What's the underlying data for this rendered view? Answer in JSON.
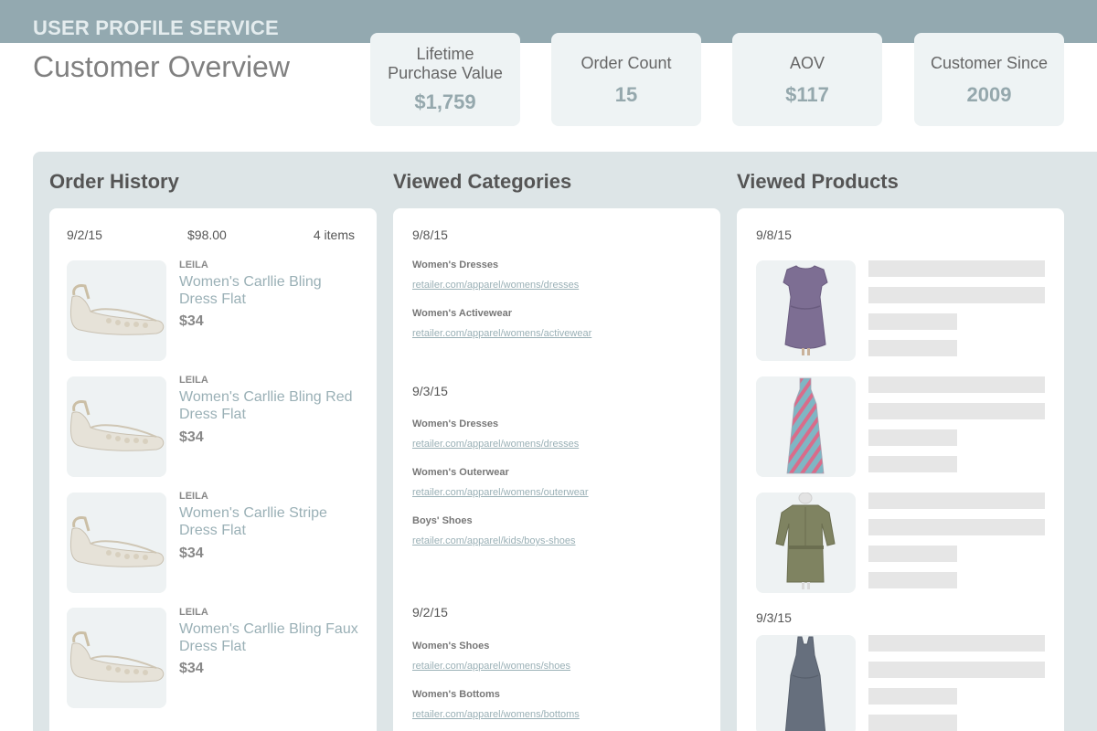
{
  "header": {
    "service_name": "USER PROFILE SERVICE",
    "page_title": "Customer Overview"
  },
  "metrics": [
    {
      "label": "Lifetime Purchase Value",
      "value": "$1,759"
    },
    {
      "label": "Order Count",
      "value": "15"
    },
    {
      "label": "AOV",
      "value": "$117"
    },
    {
      "label": "Customer Since",
      "value": "2009"
    }
  ],
  "order_history": {
    "title": "Order History",
    "order": {
      "date": "9/2/15",
      "total": "$98.00",
      "items_count": "4 items",
      "items": [
        {
          "brand": "LEILA",
          "name": "Women's Carllie Bling Dress Flat",
          "price": "$34",
          "icon": "sandal-icon"
        },
        {
          "brand": "LEILA",
          "name": "Women's Carllie Bling Red Dress Flat",
          "price": "$34",
          "icon": "sandal-icon"
        },
        {
          "brand": "LEILA",
          "name": "Women's Carllie Stripe Dress Flat",
          "price": "$34",
          "icon": "sandal-icon"
        },
        {
          "brand": "LEILA",
          "name": "Women's Carllie Bling Faux Dress Flat",
          "price": "$34",
          "icon": "sandal-icon"
        }
      ]
    }
  },
  "viewed_categories": {
    "title": "Viewed Categories",
    "groups": [
      {
        "date": "9/8/15",
        "items": [
          {
            "name": "Women's Dresses",
            "url": "retailer.com/apparel/womens/dresses"
          },
          {
            "name": "Women's Activewear",
            "url": "retailer.com/apparel/womens/activewear"
          }
        ]
      },
      {
        "date": "9/3/15",
        "items": [
          {
            "name": "Women's Dresses",
            "url": "retailer.com/apparel/womens/dresses"
          },
          {
            "name": "Women's Outerwear",
            "url": "retailer.com/apparel/womens/outerwear"
          },
          {
            "name": "Boys' Shoes",
            "url": "retailer.com/apparel/kids/boys-shoes"
          }
        ]
      },
      {
        "date": "9/2/15",
        "items": [
          {
            "name": "Women's Shoes",
            "url": "retailer.com/apparel/womens/shoes"
          },
          {
            "name": "Women's Bottoms",
            "url": "retailer.com/apparel/womens/bottoms"
          }
        ]
      }
    ]
  },
  "viewed_products": {
    "title": "Viewed Products",
    "groups": [
      {
        "date": "9/8/15",
        "products": [
          {
            "icon": "purple-dress-icon",
            "color": "#7d6e93"
          },
          {
            "icon": "striped-maxi-dress-icon",
            "color": "#d96c8a"
          },
          {
            "icon": "olive-shirt-dress-icon",
            "color": "#7f8361"
          }
        ]
      },
      {
        "date": "9/3/15",
        "products": [
          {
            "icon": "gray-maxi-dress-icon",
            "color": "#666f7d"
          }
        ]
      }
    ]
  },
  "colors": {
    "header_bar": "#93a9b0",
    "panel_bg": "#dde5e7",
    "card_bg": "#eef3f4",
    "accent_text": "#9ab0b6"
  }
}
